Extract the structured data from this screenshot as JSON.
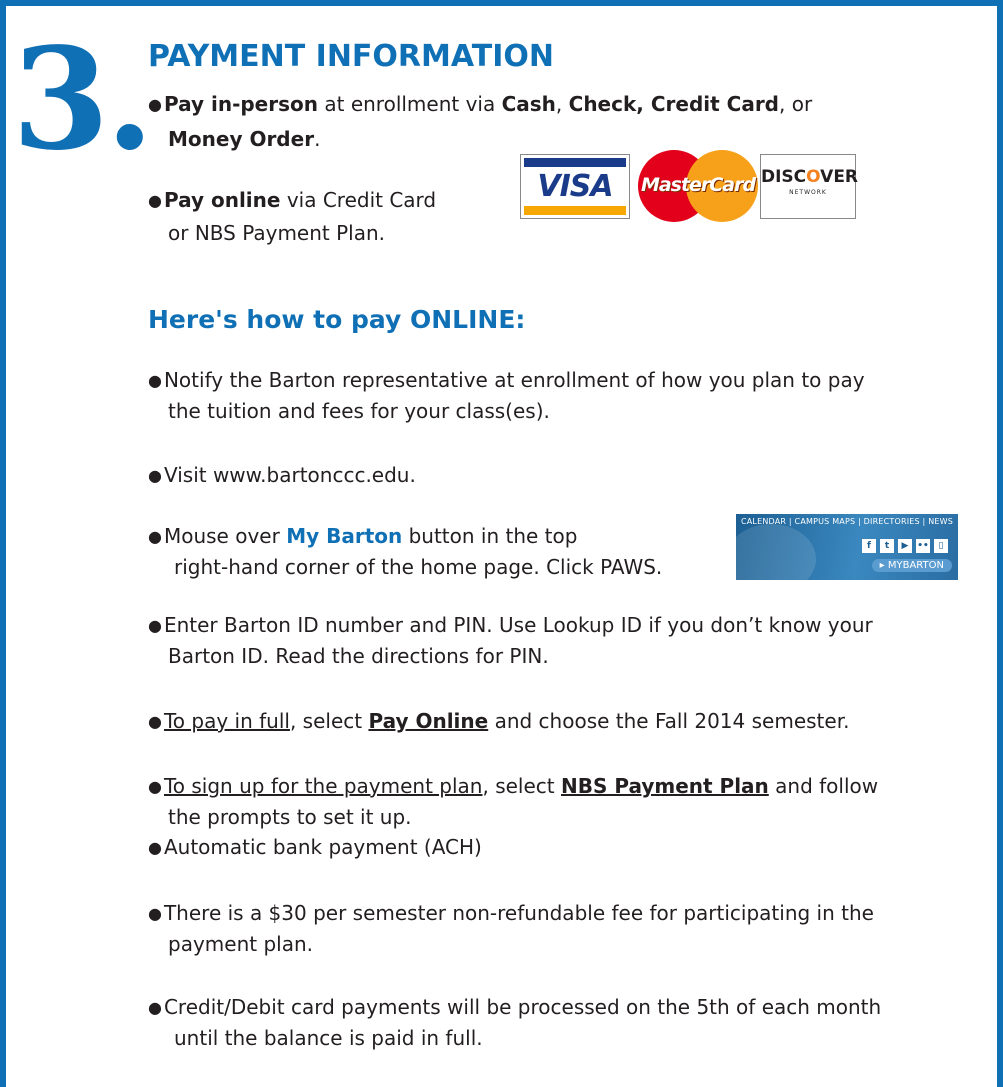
{
  "section_number": "3.",
  "title": "PAYMENT INFORMATION",
  "pay_in_person": {
    "bold": "Pay in-person",
    "t1": " at enrollment via ",
    "cash": "Cash",
    "t2": ", ",
    "check": "Check, Credit Card",
    "t3": ", or",
    "money": "Money Order",
    "t4": "."
  },
  "pay_online": {
    "bold": "Pay online",
    "t1": " via Credit Card",
    "line2": "or NBS Payment Plan."
  },
  "cards": {
    "visa": "VISA",
    "mastercard": "MasterCard",
    "discover_a": "DISC",
    "discover_o": "O",
    "discover_b": "VER",
    "discover_net": "NETWORK"
  },
  "howto_title": "Here's how to pay ONLINE:",
  "steps": {
    "s1_l1": "Notify the Barton representative at enrollment of how you plan to pay",
    "s1_l2": "the tuition and fees for your class(es).",
    "s2": "Visit www.bartonccc.edu.",
    "s3_a": "Mouse over ",
    "s3_b": "My Barton",
    "s3_c": " button in the top",
    "s3_l2": "right-hand corner of the home page.  Click PAWS.",
    "s4_l1": "Enter Barton ID number and PIN.  Use Lookup ID if you don’t know your",
    "s4_l2": "Barton ID.  Read the directions for PIN.",
    "s5_a": "To pay in full",
    "s5_b": ", select ",
    "s5_c": "Pay Online",
    "s5_d": " and choose the Fall 2014 semester.",
    "s6_a": "To sign up for the payment plan",
    "s6_b": ", select ",
    "s6_c": "NBS Payment Plan",
    "s6_d": " and follow",
    "s6_l2": "the prompts to set it up.",
    "s7": "Automatic bank payment (ACH)",
    "s8_l1": "There is a $30 per semester non-refundable fee for participating in the",
    "s8_l2": "payment plan.",
    "s9_l1": "Credit/Debit card payments will be processed on the 5th of each month",
    "s9_l2": "until the balance is paid in full."
  },
  "banner": {
    "top": "CALENDAR | CAMPUS MAPS | DIRECTORIES | NEWS",
    "my": "MY",
    "barton": "BARTON"
  },
  "colors": {
    "accent": "#1070b6"
  }
}
